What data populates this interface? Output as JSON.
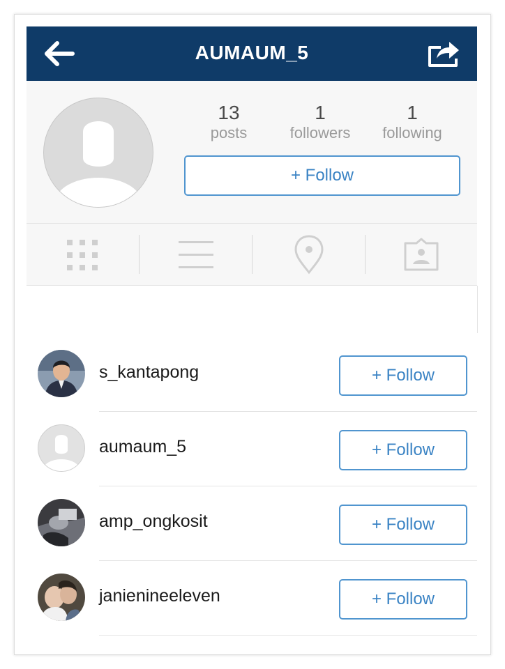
{
  "header": {
    "title": "AUMAUM_5",
    "back_icon": "arrow-left-icon",
    "share_icon": "share-icon",
    "bg_color": "#0f3b68"
  },
  "profile": {
    "stats": [
      {
        "num": "13",
        "label": "posts"
      },
      {
        "num": "1",
        "label": "followers"
      },
      {
        "num": "1",
        "label": "following"
      }
    ],
    "follow_label": "+ Follow"
  },
  "tabs": [
    {
      "icon": "grid-icon"
    },
    {
      "icon": "list-icon"
    },
    {
      "icon": "location-pin-icon"
    },
    {
      "icon": "tagged-photos-icon"
    }
  ],
  "users": [
    {
      "username": "s_kantapong",
      "follow_label": "+ Follow"
    },
    {
      "username": "aumaum_5",
      "follow_label": "+ Follow"
    },
    {
      "username": "amp_ongkosit",
      "follow_label": "+ Follow"
    },
    {
      "username": "janienineeleven",
      "follow_label": "+ Follow"
    }
  ],
  "colors": {
    "accent": "#3a83c4",
    "border": "#5095cf"
  }
}
